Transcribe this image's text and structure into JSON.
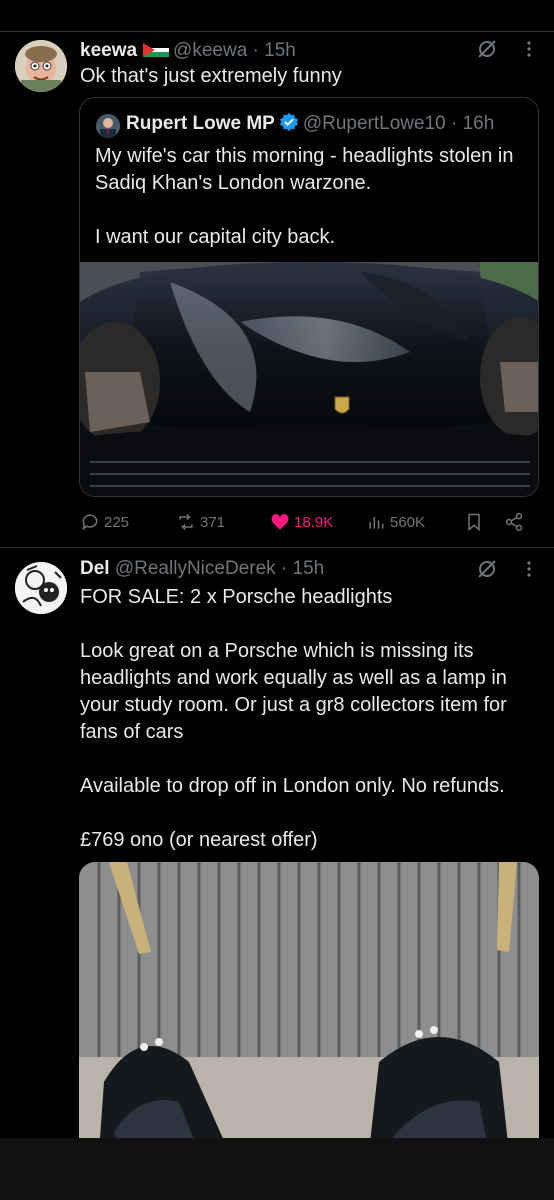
{
  "tweet1": {
    "name": "keewa",
    "handle": "@keewa",
    "time": "· 15h",
    "text": "Ok that's just extremely funny",
    "avatar_icon": "cartoon-face-avatar",
    "quote": {
      "name": "Rupert Lowe MP",
      "handle": "@RupertLowe10",
      "time": "· 16h",
      "text": "My wife's car this morning - headlights stolen in Sadiq Khan's London warzone.\n\nI want our capital city back."
    },
    "actions": {
      "replies": "225",
      "reposts": "371",
      "likes": "18.9K",
      "views": "560K"
    }
  },
  "tweet2": {
    "name": "Del",
    "handle": "@ReallyNiceDerek",
    "time": "· 15h",
    "text": "FOR SALE: 2 x Porsche headlights\n\nLook great on a Porsche which is missing its headlights and work equally as well as a lamp in your study room. Or just a gr8 collectors item for fans of cars\n\nAvailable to drop off in London only. No refunds.\n\n£769 ono (or nearest offer)",
    "avatar_icon": "sketch-avatar"
  },
  "colors": {
    "background": "#000000",
    "text": "#e7e9ea",
    "muted": "#71767b",
    "like": "#f91880",
    "verified": "#1d9bf0",
    "border": "#2f3336"
  }
}
